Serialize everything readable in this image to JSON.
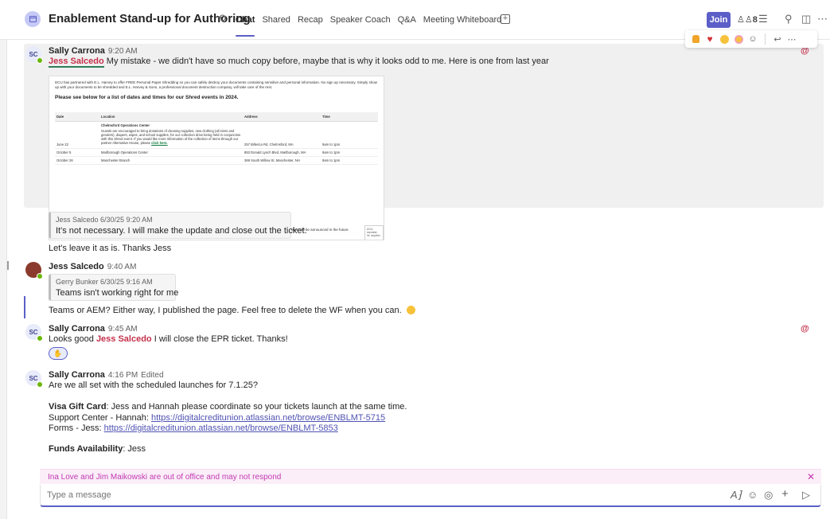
{
  "header": {
    "title": "Enablement Stand-up for Authoring",
    "tabs": [
      "Chat",
      "Shared",
      "Recap",
      "Speaker Coach",
      "Q&A",
      "Meeting Whiteboard"
    ],
    "join_label": "Join",
    "participants_count": "8"
  },
  "messages": [
    {
      "initials": "SC",
      "author": "Sally Carrona",
      "time": "9:20 AM",
      "mention": "Jess Salcedo",
      "text": " My mistake - we didn't have so much copy before, maybe that is why it looks odd to me.  Here is one from last year",
      "quote_meta": "Jess Salcedo  6/30/25 9:20 AM",
      "quote_text": "It's not necessary. I will make the update and close out the ticket.",
      "after_text": "Let's leave it as is.  Thanks Jess"
    },
    {
      "author": "Jess Salcedo",
      "time": "9:40 AM",
      "quote_meta": "Gerry Bunker  6/30/25 9:16 AM",
      "quote_text": "Teams isn't working right for me",
      "text": "Teams or AEM? Either way, I published the page. Feel free to delete the WF when you can."
    },
    {
      "initials": "SC",
      "author": "Sally Carrona",
      "time": "9:45 AM",
      "text_before": "Looks good ",
      "mention": "Jess Salcedo",
      "text_after": " I will close the EPR ticket.  Thanks!"
    },
    {
      "initials": "SC",
      "author": "Sally Carrona",
      "time": "4:16 PM",
      "edited": "Edited",
      "line1": "Are we all set with the scheduled launches for 7.1.25?",
      "visa_label": "Visa Gift Card",
      "visa_text": ":  Jess and Hannah please coordinate so your tickets launch at the same time.",
      "support_label": "Support Center - Hannah:  ",
      "support_link": "https://digitalcreditunion.atlassian.net/browse/ENBLMT-5715",
      "forms_label": "Forms - Jess:  ",
      "forms_link": "https://digitalcreditunion.atlassian.net/browse/ENBLMT-5853",
      "funds_label": "Funds Availability",
      "funds_text": ":  Jess"
    }
  ],
  "document": {
    "intro": "DCU has partnered with E.L. Harvey to offer FREE Personal Paper Shredding so you can safely destroy your documents containing sensitive and personal information. No sign up necessary. Simply show up with your documents to be shredded and E.L. Harvey & Sons, a professional document destruction company, will take care of the rest.",
    "heading": "Please see below for a list of dates and times for our Shred events in 2024.",
    "columns": [
      "Date",
      "Location",
      "Address",
      "Time"
    ],
    "row1": {
      "date": "June 22",
      "loc_title": "Chelmsford Operations Center",
      "loc_body": "Guests are encouraged to bring donations of cleaning supplies, new clothing (all sizes and genders), diapers, wipes, and school supplies, for our collection drive being held in conjunction with this Shred event. If you would like more information of the collection of items through our partner Alternative House, please",
      "loc_link": "click here.",
      "address": "257 Billerica Rd, Chelmsford, MA",
      "time": "9am to 1pm"
    },
    "row2": {
      "date": "October 5",
      "location": "Marlborough Operations Center",
      "address": "853 Donald Lynch Blvd, Marlborough, MA",
      "time": "9am to 1pm"
    },
    "row3": {
      "date": "October 26",
      "location": "Manchester Branch",
      "address": "369 South Willow St, Manchester, NH",
      "time": "9am to 1pm"
    },
    "footer": "Guests will be encouraged to bring donations for our collection drives being held in conjunction with each shred event. Nonprofit partners for each location will be announced in the future.",
    "tooltip": "DCU member Hi, anythin"
  },
  "banner": {
    "oof_text": "Ina Love and Jim Maikowski are out of office and may not respond"
  },
  "compose": {
    "placeholder": "Type a message"
  }
}
